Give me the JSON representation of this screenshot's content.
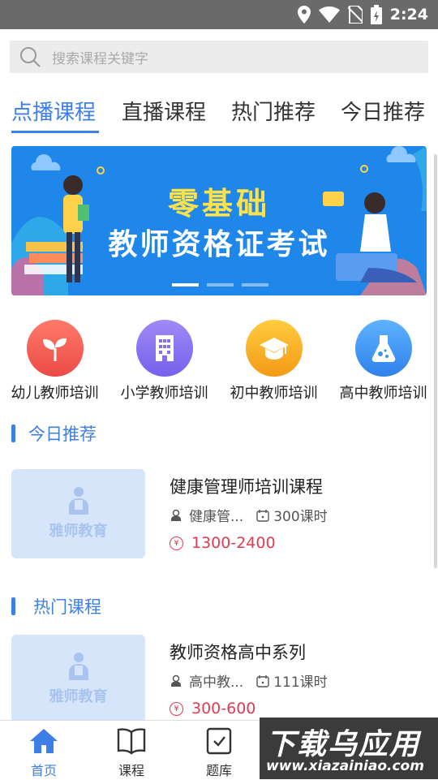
{
  "status_bar": {
    "time": "2:24",
    "icons": [
      "location-icon",
      "wifi-icon",
      "no-sim-icon",
      "battery-icon"
    ]
  },
  "search": {
    "placeholder": "搜索课程关键字"
  },
  "tabs": [
    {
      "label": "点播课程",
      "active": true
    },
    {
      "label": "直播课程",
      "active": false
    },
    {
      "label": "热门推荐",
      "active": false
    },
    {
      "label": "今日推荐",
      "active": false
    }
  ],
  "banner": {
    "line1": "零基础",
    "line2": "教师资格证考试",
    "slides": 3,
    "active_slide": 1
  },
  "categories": [
    {
      "label": "幼儿教师培训",
      "icon": "sprout-icon",
      "color": "#f0584f"
    },
    {
      "label": "小学教师培训",
      "icon": "building-icon",
      "color": "#8b73f0"
    },
    {
      "label": "初中教师培训",
      "icon": "graduation-cap-icon",
      "color": "#f6a51f"
    },
    {
      "label": "高中教师培训",
      "icon": "flask-icon",
      "color": "#3d93ee"
    }
  ],
  "sections": [
    {
      "title": "今日推荐",
      "course": {
        "thumb_text": "雅师教育",
        "title": "健康管理师培训课程",
        "teacher": "健康管...",
        "lessons": "300课时",
        "price": "1300-2400"
      }
    },
    {
      "title": "热门课程",
      "course": {
        "thumb_text": "雅师教育",
        "title": "教师资格高中系列",
        "teacher": "高中教...",
        "lessons": "111课时",
        "price": "300-600"
      }
    }
  ],
  "bottom_nav": [
    {
      "label": "首页",
      "icon": "home-icon",
      "active": true
    },
    {
      "label": "课程",
      "icon": "book-icon",
      "active": false
    },
    {
      "label": "题库",
      "icon": "checklist-icon",
      "active": false
    },
    {
      "label": "",
      "icon": "chat-icon",
      "active": false
    },
    {
      "label": "",
      "icon": "user-icon",
      "active": false
    }
  ],
  "watermark": {
    "main": "下载乌应用",
    "url": "www.xiazainiao.com"
  },
  "colors": {
    "accent": "#3e7fe6",
    "price": "#e23b4f",
    "status_bar": "#6a6a6a"
  }
}
